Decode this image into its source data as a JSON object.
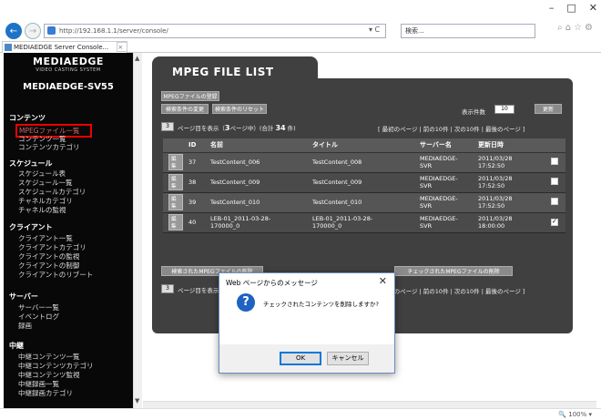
{
  "browser": {
    "address": "http://192.168.1.1/server/console/",
    "search_placeholder": "検索...",
    "tab_title": "MEDIAEDGE Server Console...",
    "zoom": "100%",
    "addr_tools": "▾ C"
  },
  "sidebar": {
    "brand_name": "MEDIAEDGE",
    "brand_sub": "VIDEO CASTING SYSTEM",
    "product": "MEDIAEDGE-SV55",
    "sections": [
      {
        "label": "コンテンツ",
        "items": [
          "MPEGファイル一覧",
          "コンテンツ一覧",
          "コンテンツカテゴリ"
        ]
      },
      {
        "label": "スケジュール",
        "items": [
          "スケジュール表",
          "スケジュール一覧",
          "スケジュールカテゴリ",
          "チャネルカテゴリ",
          "チャネルの監視"
        ]
      },
      {
        "label": "クライアント",
        "items": [
          "クライアント一覧",
          "クライアントカテゴリ",
          "クライアントの監視",
          "クライアントの制御",
          "クライアントのリブート"
        ]
      },
      {
        "label": "サーバー",
        "items": [
          "サーバー一覧",
          "イベントログ",
          "録画"
        ]
      },
      {
        "label": "中継",
        "items": [
          "中継コンテンツ一覧",
          "中継コンテンツカテゴリ",
          "中継コンテンツ監視",
          "中継録画一覧",
          "中継録画カテゴリ"
        ]
      }
    ]
  },
  "main": {
    "title": "MPEG FILE LIST",
    "register_btn": "MPEGファイルの登録",
    "search_change_btn": "検索条件の変更",
    "search_reset_btn": "検索条件のリセット",
    "display_count_label": "表示件数",
    "display_count_value": "10",
    "update_btn": "更新",
    "page_info_prefix": "ページ目を表示（",
    "page_num": "3",
    "page_info_mid": "ページ中）(合計",
    "total": "34",
    "page_info_suffix": "件)",
    "page_select": "3",
    "pager_top": "[ 最初のページ | 前の10件 | 次の10件 | 最後のページ ]",
    "pager_bottom": "[ 最初のページ | 前の10件 | 次の10件 | 最後のページ ]",
    "columns": [
      "ID",
      "名前",
      "タイトル",
      "サーバー名",
      "更新日時"
    ],
    "rows": [
      {
        "id": "37",
        "name": "TestContent_006",
        "title": "TestContent_008",
        "server": "MEDIAEDGE-\nSVR",
        "updated": "2011/03/28\n17:52:50",
        "checked": false
      },
      {
        "id": "38",
        "name": "TestContent_009",
        "title": "TestContent_009",
        "server": "MEDIAEDGE-\nSVR",
        "updated": "2011/03/28\n17:52:50",
        "checked": false
      },
      {
        "id": "39",
        "name": "TestContent_010",
        "title": "TestContent_010",
        "server": "MEDIAEDGE-\nSVR",
        "updated": "2011/03/28\n17:52:50",
        "checked": false
      },
      {
        "id": "40",
        "name": "LEB-01_2011-03-28-\n170000_0",
        "title": "LEB-01_2011-03-28-\n170000_0",
        "server": "MEDIAEDGE-\nSVR",
        "updated": "2011/03/28\n18:00:00",
        "checked": true
      }
    ],
    "edit_label": "編集",
    "delete_searched_btn": "検索されたMPEGファイルの削除",
    "delete_checked_btn": "チェックされたMPEGファイルの削除"
  },
  "dialog": {
    "title": "Web ページからのメッセージ",
    "message": "チェックされたコンテンツを削除しますか?",
    "ok": "OK",
    "cancel": "キャンセル",
    "icon_glyph": "?",
    "close_glyph": "✕"
  },
  "colors": {
    "sidebar_bg": "#080808",
    "panel_bg": "#404040",
    "highlight_border": "#e00000",
    "dialog_icon": "#1e62c2"
  }
}
